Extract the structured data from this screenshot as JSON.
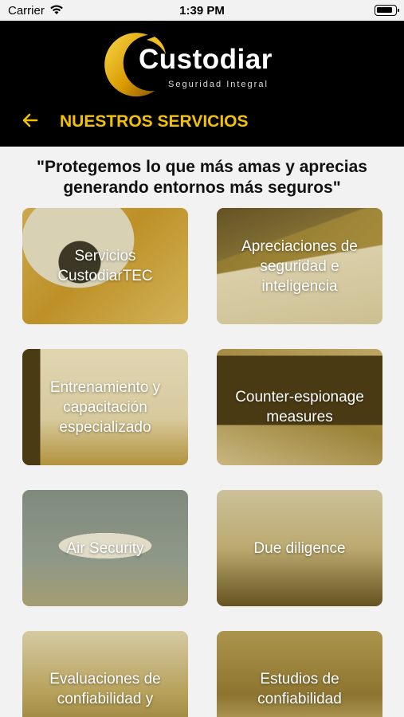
{
  "status_bar": {
    "carrier": "Carrier",
    "time": "1:39 PM"
  },
  "header": {
    "logo_text": "Custodiar",
    "logo_subtitle": "Seguridad Integral",
    "title": "NUESTROS SERVICIOS"
  },
  "quote": {
    "line1": "\"Protegemos lo que más amas y aprecias",
    "line2": "generando entornos más seguros\""
  },
  "services": [
    {
      "label": "Servicios CustodiarTEC"
    },
    {
      "label": "Apreciaciones de seguridad e inteligencia"
    },
    {
      "label": "Entrenamiento y capacitación especializado"
    },
    {
      "label": "Counter-espionage measures"
    },
    {
      "label": "Air Security"
    },
    {
      "label": "Due diligence"
    },
    {
      "label": "Evaluaciones de confiabilidad y"
    },
    {
      "label": "Estudios de confiabilidad"
    }
  ],
  "colors": {
    "header_bg": "#000000",
    "accent": "#f2c200",
    "page_bg": "#f2f2f2"
  }
}
